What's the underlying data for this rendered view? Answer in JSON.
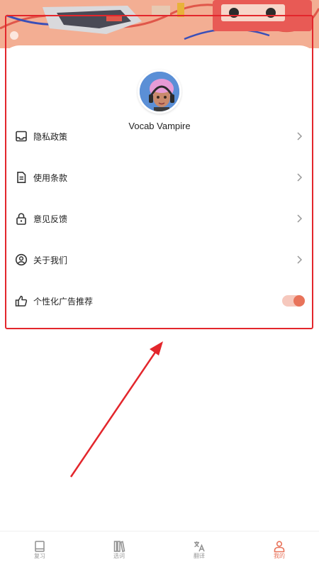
{
  "profile": {
    "username": "Vocab Vampire"
  },
  "menu": {
    "items": [
      {
        "label": "隐私政策",
        "icon": "inbox-icon"
      },
      {
        "label": "使用条款",
        "icon": "document-icon"
      },
      {
        "label": "意见反馈",
        "icon": "lock-icon"
      },
      {
        "label": "关于我们",
        "icon": "user-circle-icon"
      },
      {
        "label": "个性化广告推荐",
        "icon": "thumbs-up-icon"
      }
    ],
    "ad_toggle_on": true
  },
  "tabbar": {
    "tabs": [
      {
        "label": "复习",
        "icon": "book-icon",
        "active": false
      },
      {
        "label": "选词",
        "icon": "library-icon",
        "active": false
      },
      {
        "label": "翻译",
        "icon": "translate-icon",
        "active": false
      },
      {
        "label": "我的",
        "icon": "person-icon",
        "active": true
      }
    ]
  },
  "colors": {
    "accent": "#e8735a",
    "annotation": "#e3262c",
    "banner": "#f2a688"
  }
}
